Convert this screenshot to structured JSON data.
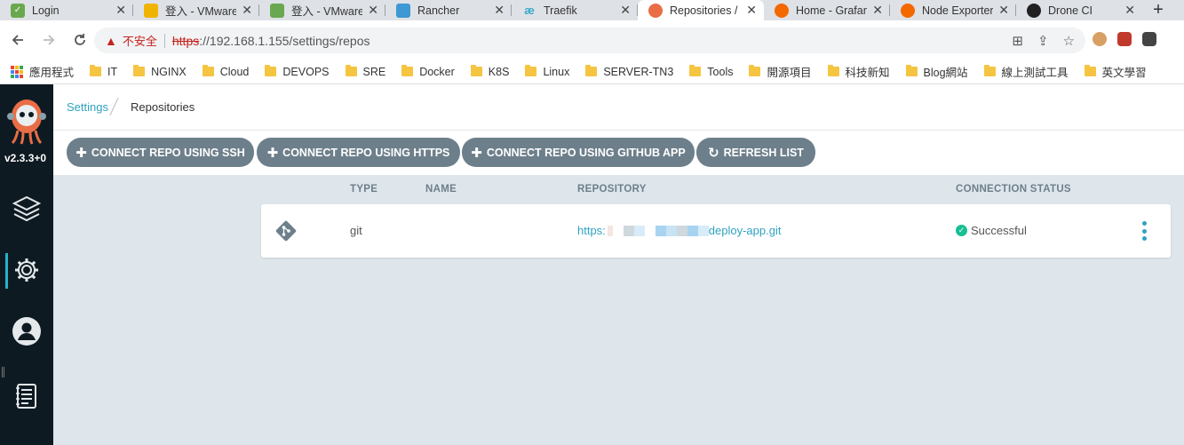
{
  "browser": {
    "tabs": [
      {
        "title": "Login",
        "favicon": "leaf-icon",
        "color": "#6aa84f"
      },
      {
        "title": "登入 - VMware",
        "favicon": "vmware-icon",
        "color": "#f0b400"
      },
      {
        "title": "登入 - VMware",
        "favicon": "vmware-icon",
        "color": "#6aa84f"
      },
      {
        "title": "Rancher",
        "favicon": "rancher-icon",
        "color": "#3d98d3"
      },
      {
        "title": "Traefik",
        "favicon": "traefik-icon",
        "color": "#37abc8"
      },
      {
        "title": "Repositories /",
        "favicon": "argo-icon",
        "color": "#e96d45",
        "active": true
      },
      {
        "title": "Home - Grafana",
        "favicon": "grafana-icon",
        "color": "#f46800"
      },
      {
        "title": "Node Exporter",
        "favicon": "grafana-icon",
        "color": "#f46800"
      },
      {
        "title": "Drone CI",
        "favicon": "drone-icon",
        "color": "#212121"
      }
    ],
    "close_glyph": "✕",
    "new_tab_glyph": "+",
    "insecure_label": "不安全",
    "url_scheme": "https",
    "url_rest": "://192.168.1.155/settings/repos",
    "bookmarks": [
      "應用程式",
      "IT",
      "NGINX",
      "Cloud",
      "DEVOPS",
      "SRE",
      "Docker",
      "K8S",
      "Linux",
      "SERVER-TN3",
      "Tools",
      "開源項目",
      "科技新知",
      "Blog網站",
      "線上測試工具",
      "英文學習"
    ]
  },
  "sidebar": {
    "version": "v2.3.3+0",
    "items": [
      {
        "name": "applications-icon"
      },
      {
        "name": "settings-icon",
        "active": true
      },
      {
        "name": "user-icon"
      },
      {
        "name": "docs-icon"
      }
    ]
  },
  "breadcrumb": {
    "parent": "Settings",
    "current": "Repositories"
  },
  "toolbar": {
    "buttons": [
      {
        "label": "CONNECT REPO USING SSH",
        "icon": "plus-icon"
      },
      {
        "label": "CONNECT REPO USING HTTPS",
        "icon": "plus-icon"
      },
      {
        "label": "CONNECT REPO USING GITHUB APP",
        "icon": "plus-icon"
      },
      {
        "label": "REFRESH LIST",
        "icon": "refresh-icon"
      }
    ]
  },
  "table": {
    "headers": {
      "type": "TYPE",
      "name": "NAME",
      "repository": "REPOSITORY",
      "status": "CONNECTION STATUS"
    },
    "rows": [
      {
        "type": "git",
        "name": "",
        "repo_prefix": "https:",
        "repo_suffix": "deploy-app.git",
        "status": "Successful"
      }
    ]
  },
  "colors": {
    "accent": "#2fa3c1",
    "button_bg": "#6d7f8b",
    "sidebar_bg": "#0e1a22",
    "success": "#18be94",
    "content_bg": "#dee6eb"
  }
}
